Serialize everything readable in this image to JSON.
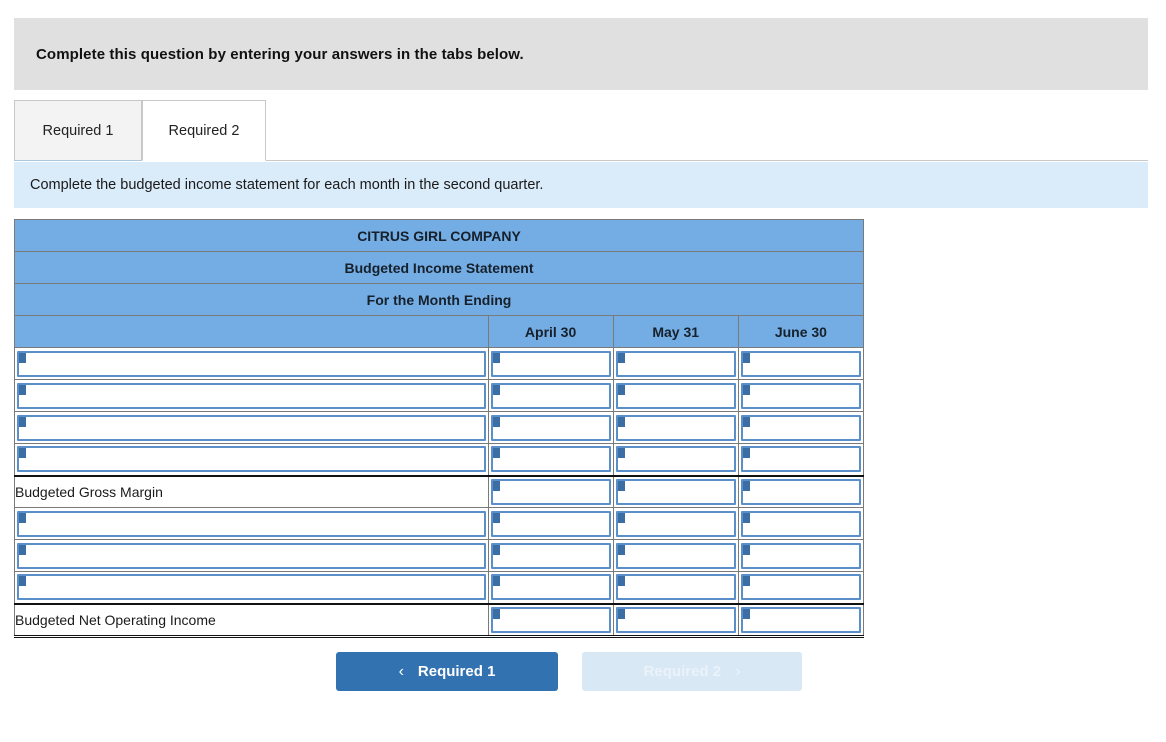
{
  "banner": {
    "text": "Complete this question by entering your answers in the tabs below."
  },
  "tabs": [
    {
      "label": "Required 1",
      "active": false
    },
    {
      "label": "Required 2",
      "active": true
    }
  ],
  "instruction": {
    "text": "Complete the budgeted income statement for each month in the second quarter."
  },
  "worksheet": {
    "title_lines": [
      "CITRUS GIRL COMPANY",
      "Budgeted Income Statement",
      "For the Month Ending"
    ],
    "column_headers": [
      "",
      "April 30",
      "May 31",
      "June 30"
    ],
    "rows": [
      {
        "label": "",
        "label_type": "input",
        "values": [
          "",
          "",
          ""
        ],
        "value_type": "input",
        "rule_top": false,
        "rule_bottom": false
      },
      {
        "label": "",
        "label_type": "input",
        "values": [
          "",
          "",
          ""
        ],
        "value_type": "input",
        "rule_top": false,
        "rule_bottom": false
      },
      {
        "label": "",
        "label_type": "input",
        "values": [
          "",
          "",
          ""
        ],
        "value_type": "input",
        "rule_top": false,
        "rule_bottom": false
      },
      {
        "label": "",
        "label_type": "input",
        "values": [
          "",
          "",
          ""
        ],
        "value_type": "input",
        "rule_top": false,
        "rule_bottom": false
      },
      {
        "label": "Budgeted Gross Margin",
        "label_type": "static",
        "values": [
          "",
          "",
          ""
        ],
        "value_type": "input",
        "rule_top": true,
        "rule_bottom": false
      },
      {
        "label": "",
        "label_type": "input",
        "values": [
          "",
          "",
          ""
        ],
        "value_type": "input",
        "rule_top": false,
        "rule_bottom": false
      },
      {
        "label": "",
        "label_type": "input",
        "values": [
          "",
          "",
          ""
        ],
        "value_type": "input",
        "rule_top": false,
        "rule_bottom": false
      },
      {
        "label": "",
        "label_type": "input",
        "values": [
          "",
          "",
          ""
        ],
        "value_type": "input",
        "rule_top": false,
        "rule_bottom": false
      },
      {
        "label": "Budgeted Net Operating Income",
        "label_type": "static",
        "values": [
          "",
          "",
          ""
        ],
        "value_type": "input",
        "rule_top": true,
        "rule_bottom": true
      }
    ]
  },
  "nav": {
    "prev": {
      "label": "Required 1",
      "icon": "chevron-left-icon",
      "glyph": "‹",
      "state": "enabled"
    },
    "next": {
      "label": "Required 2",
      "icon": "chevron-right-icon",
      "glyph": "›",
      "state": "disabled"
    }
  },
  "colors": {
    "banner_bg": "#e0e0e0",
    "instruction_bg": "#daebfa",
    "sheet_header_bg": "#74ace4",
    "input_border": "#5b8fc9",
    "flag": "#3a6ea5",
    "primary_button": "#3272b0",
    "muted_button": "#d9e8f5"
  }
}
